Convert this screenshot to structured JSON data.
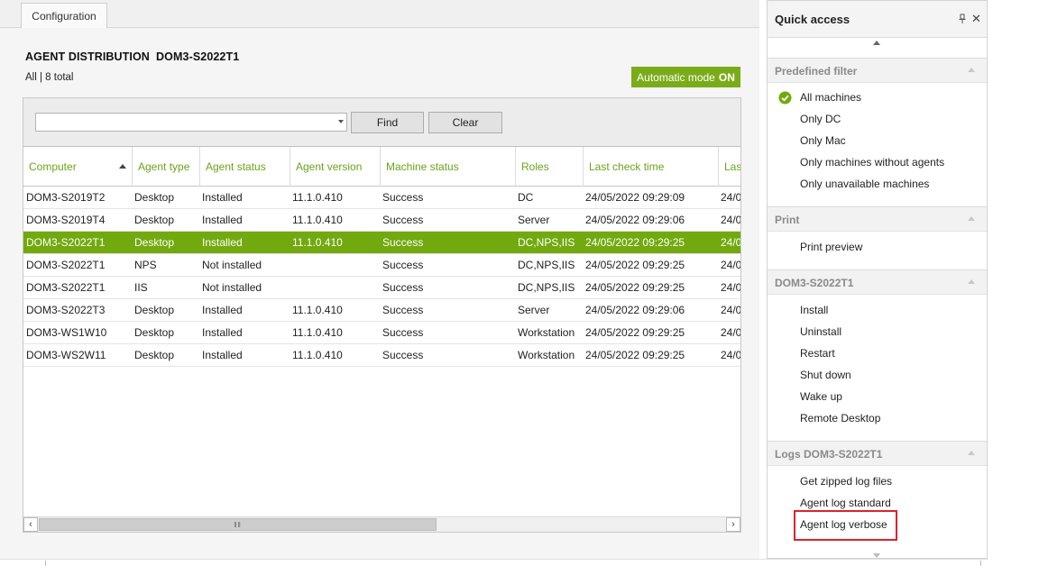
{
  "tabs": [
    {
      "label": "Configuration"
    }
  ],
  "header": {
    "title": "AGENT DISTRIBUTION  DOM3-S2022T1",
    "subtitle": "All | 8 total",
    "auto_mode_label": "Automatic mode",
    "auto_mode_state": "ON"
  },
  "search": {
    "value": "",
    "find_label": "Find",
    "clear_label": "Clear"
  },
  "table": {
    "columns": [
      "Computer",
      "Agent type",
      "Agent status",
      "Agent version",
      "Machine status",
      "Roles",
      "Last check time",
      "Last"
    ],
    "rows": [
      [
        "DOM3-S2019T2",
        "Desktop",
        "Installed",
        "11.1.0.410",
        "Success",
        "DC",
        "24/05/2022 09:29:09",
        "24/0"
      ],
      [
        "DOM3-S2019T4",
        "Desktop",
        "Installed",
        "11.1.0.410",
        "Success",
        "Server",
        "24/05/2022 09:29:06",
        "24/0"
      ],
      [
        "DOM3-S2022T1",
        "Desktop",
        "Installed",
        "11.1.0.410",
        "Success",
        "DC,NPS,IIS",
        "24/05/2022 09:29:25",
        "24/0"
      ],
      [
        "DOM3-S2022T1",
        "NPS",
        "Not installed",
        "",
        "Success",
        "DC,NPS,IIS",
        "24/05/2022 09:29:25",
        "24/0"
      ],
      [
        "DOM3-S2022T1",
        "IIS",
        "Not installed",
        "",
        "Success",
        "DC,NPS,IIS",
        "24/05/2022 09:29:25",
        "24/0"
      ],
      [
        "DOM3-S2022T3",
        "Desktop",
        "Installed",
        "11.1.0.410",
        "Success",
        "Server",
        "24/05/2022 09:29:06",
        "24/0"
      ],
      [
        "DOM3-WS1W10",
        "Desktop",
        "Installed",
        "11.1.0.410",
        "Success",
        "Workstation",
        "24/05/2022 09:29:25",
        "24/0"
      ],
      [
        "DOM3-WS2W11",
        "Desktop",
        "Installed",
        "11.1.0.410",
        "Success",
        "Workstation",
        "24/05/2022 09:29:25",
        "24/0"
      ]
    ],
    "selected_row": 2,
    "sort_column": "Computer",
    "sort_direction": "ascending"
  },
  "quick_access": {
    "title": "Quick access",
    "sections": [
      {
        "title": "Predefined filter",
        "items": [
          "All machines",
          "Only DC",
          "Only Mac",
          "Only machines without agents",
          "Only unavailable machines"
        ],
        "checked_item": "All machines"
      },
      {
        "title": "Print",
        "items": [
          "Print preview"
        ]
      },
      {
        "title": "DOM3-S2022T1",
        "items": [
          "Install",
          "Uninstall",
          "Restart",
          "Shut down",
          "Wake up",
          "Remote Desktop"
        ]
      },
      {
        "title": "Logs DOM3-S2022T1",
        "items": [
          "Get zipped log files",
          "Agent log standard",
          "Agent log verbose"
        ],
        "highlighted_item": "Agent log verbose"
      }
    ]
  },
  "colors": {
    "accent": "#72a90f",
    "header_text": "#6aa31a",
    "highlight": "#d9232d"
  },
  "icons": {
    "pin": "pin-icon",
    "close": "close-icon",
    "check": "check-circle-icon"
  }
}
